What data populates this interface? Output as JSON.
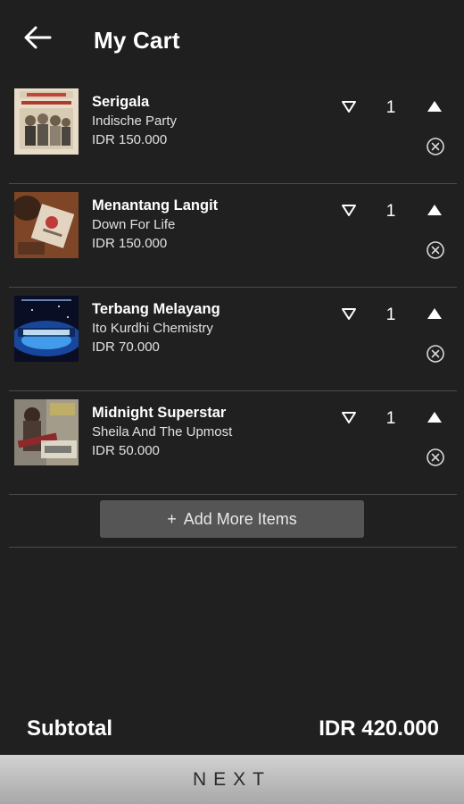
{
  "header": {
    "title": "My Cart"
  },
  "items": [
    {
      "title": "Serigala",
      "artist": "Indische Party",
      "price": "IDR 150.000",
      "qty": "1"
    },
    {
      "title": "Menantang Langit",
      "artist": "Down For Life",
      "price": "IDR 150.000",
      "qty": "1"
    },
    {
      "title": "Terbang Melayang",
      "artist": "Ito Kurdhi Chemistry",
      "price": "IDR 70.000",
      "qty": "1"
    },
    {
      "title": "Midnight Superstar",
      "artist": "Sheila And The Upmost",
      "price": "IDR 50.000",
      "qty": "1"
    }
  ],
  "add_more": {
    "plus": "+",
    "label": "Add More Items"
  },
  "subtotal": {
    "label": "Subtotal",
    "value": "IDR 420.000"
  },
  "next": {
    "label": "NEXT"
  },
  "colors": {
    "background": "#202020",
    "divider": "#4a4a4a",
    "button": "#555555",
    "next_bg": "#c0c0c0"
  },
  "icons": {
    "back": "arrow-left-icon",
    "decrease": "triangle-down-outline-icon",
    "increase": "triangle-up-filled-icon",
    "remove": "circle-x-icon"
  }
}
